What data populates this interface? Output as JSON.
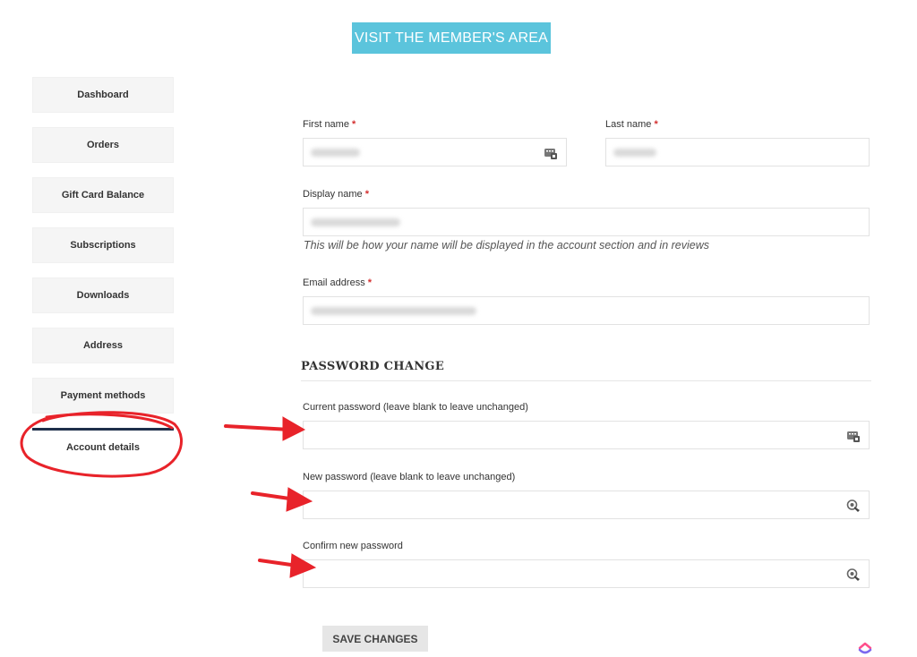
{
  "header": {
    "member_button": "VISIT THE MEMBER'S AREA"
  },
  "sidebar": {
    "items": [
      {
        "label": "Dashboard"
      },
      {
        "label": "Orders"
      },
      {
        "label": "Gift Card Balance"
      },
      {
        "label": "Subscriptions"
      },
      {
        "label": "Downloads"
      },
      {
        "label": "Address"
      },
      {
        "label": "Payment methods"
      },
      {
        "label": "Account details",
        "active": true
      }
    ]
  },
  "form": {
    "first_name": {
      "label": "First name",
      "required_mark": "*"
    },
    "last_name": {
      "label": "Last name",
      "required_mark": "*"
    },
    "display_name": {
      "label": "Display name",
      "required_mark": "*",
      "help": "This will be how your name will be displayed in the account section and in reviews"
    },
    "email": {
      "label": "Email address",
      "required_mark": "*"
    },
    "password_section": {
      "title": "PASSWORD CHANGE",
      "current": {
        "label": "Current password (leave blank to leave unchanged)"
      },
      "new": {
        "label": "New password (leave blank to leave unchanged)"
      },
      "confirm": {
        "label": "Confirm new password"
      }
    },
    "save_label": "SAVE CHANGES"
  },
  "colors": {
    "accent": "#5bc4dc",
    "annotation": "#e8232a",
    "active_border": "#1f2f4a"
  },
  "icons": {
    "autofill": "contact-card-icon",
    "password_manager": "key-icon",
    "watermark": "clickup-logo"
  }
}
